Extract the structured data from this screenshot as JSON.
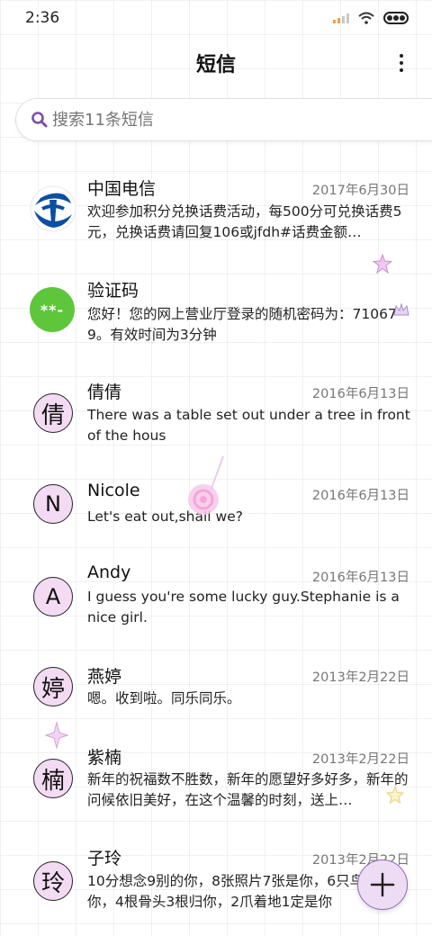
{
  "status_bar": {
    "time": "2:36"
  },
  "header": {
    "title": "短信"
  },
  "search": {
    "placeholder": "搜索11条短信"
  },
  "conversations": [
    {
      "name": "中国电信",
      "date": "2017年6月30日",
      "preview": "欢迎参加积分兑换话费活动，每500分可兑换话费5元，兑换话费请回复106或jfdh#话费金额…",
      "avatar": {
        "type": "logo",
        "icon": "china-telecom-logo"
      }
    },
    {
      "name": "验证码",
      "date": "",
      "preview": "您好！您的网上营业厅登录的随机密码为：710679。有效时间为3分钟",
      "avatar": {
        "type": "badge",
        "text": "**-",
        "color": "#5ec63a"
      }
    },
    {
      "name": "倩倩",
      "date": "2016年6月13日",
      "preview": "There was a table set out under a tree in front of the hous",
      "avatar": {
        "type": "letter",
        "text": "倩"
      }
    },
    {
      "name": "Nicole",
      "date": "2016年6月13日",
      "preview": "Let's eat out,shall we?",
      "avatar": {
        "type": "letter",
        "text": "N"
      }
    },
    {
      "name": "Andy",
      "date": "2016年6月13日",
      "preview": "I guess you're some lucky guy.Stephanie is a nice girl.",
      "avatar": {
        "type": "letter",
        "text": "A"
      }
    },
    {
      "name": "燕婷",
      "date": "2013年2月22日",
      "preview": "嗯。收到啦。同乐同乐。",
      "avatar": {
        "type": "letter",
        "text": "婷"
      }
    },
    {
      "name": "紫楠",
      "date": "2013年2月22日",
      "preview": "新年的祝福数不胜数，新年的愿望好多好多，新年的问候依旧美好，在这个温馨的时刻，送上…",
      "avatar": {
        "type": "letter",
        "text": "楠"
      }
    },
    {
      "name": "子玲",
      "date": "2013年2月22日",
      "preview": "10分想念9别的你，8张照片7张是你，6只鸟只像你，4根骨头3根归你，2爪着地1定是你",
      "avatar": {
        "type": "letter",
        "text": "玲"
      }
    }
  ],
  "fab": {
    "icon": "plus-icon"
  },
  "colors": {
    "accent": "#8a6bb5",
    "fab_bg": "#eedcf5",
    "avatar_bg": "#f3dcf3",
    "badge_green": "#5ec63a"
  }
}
